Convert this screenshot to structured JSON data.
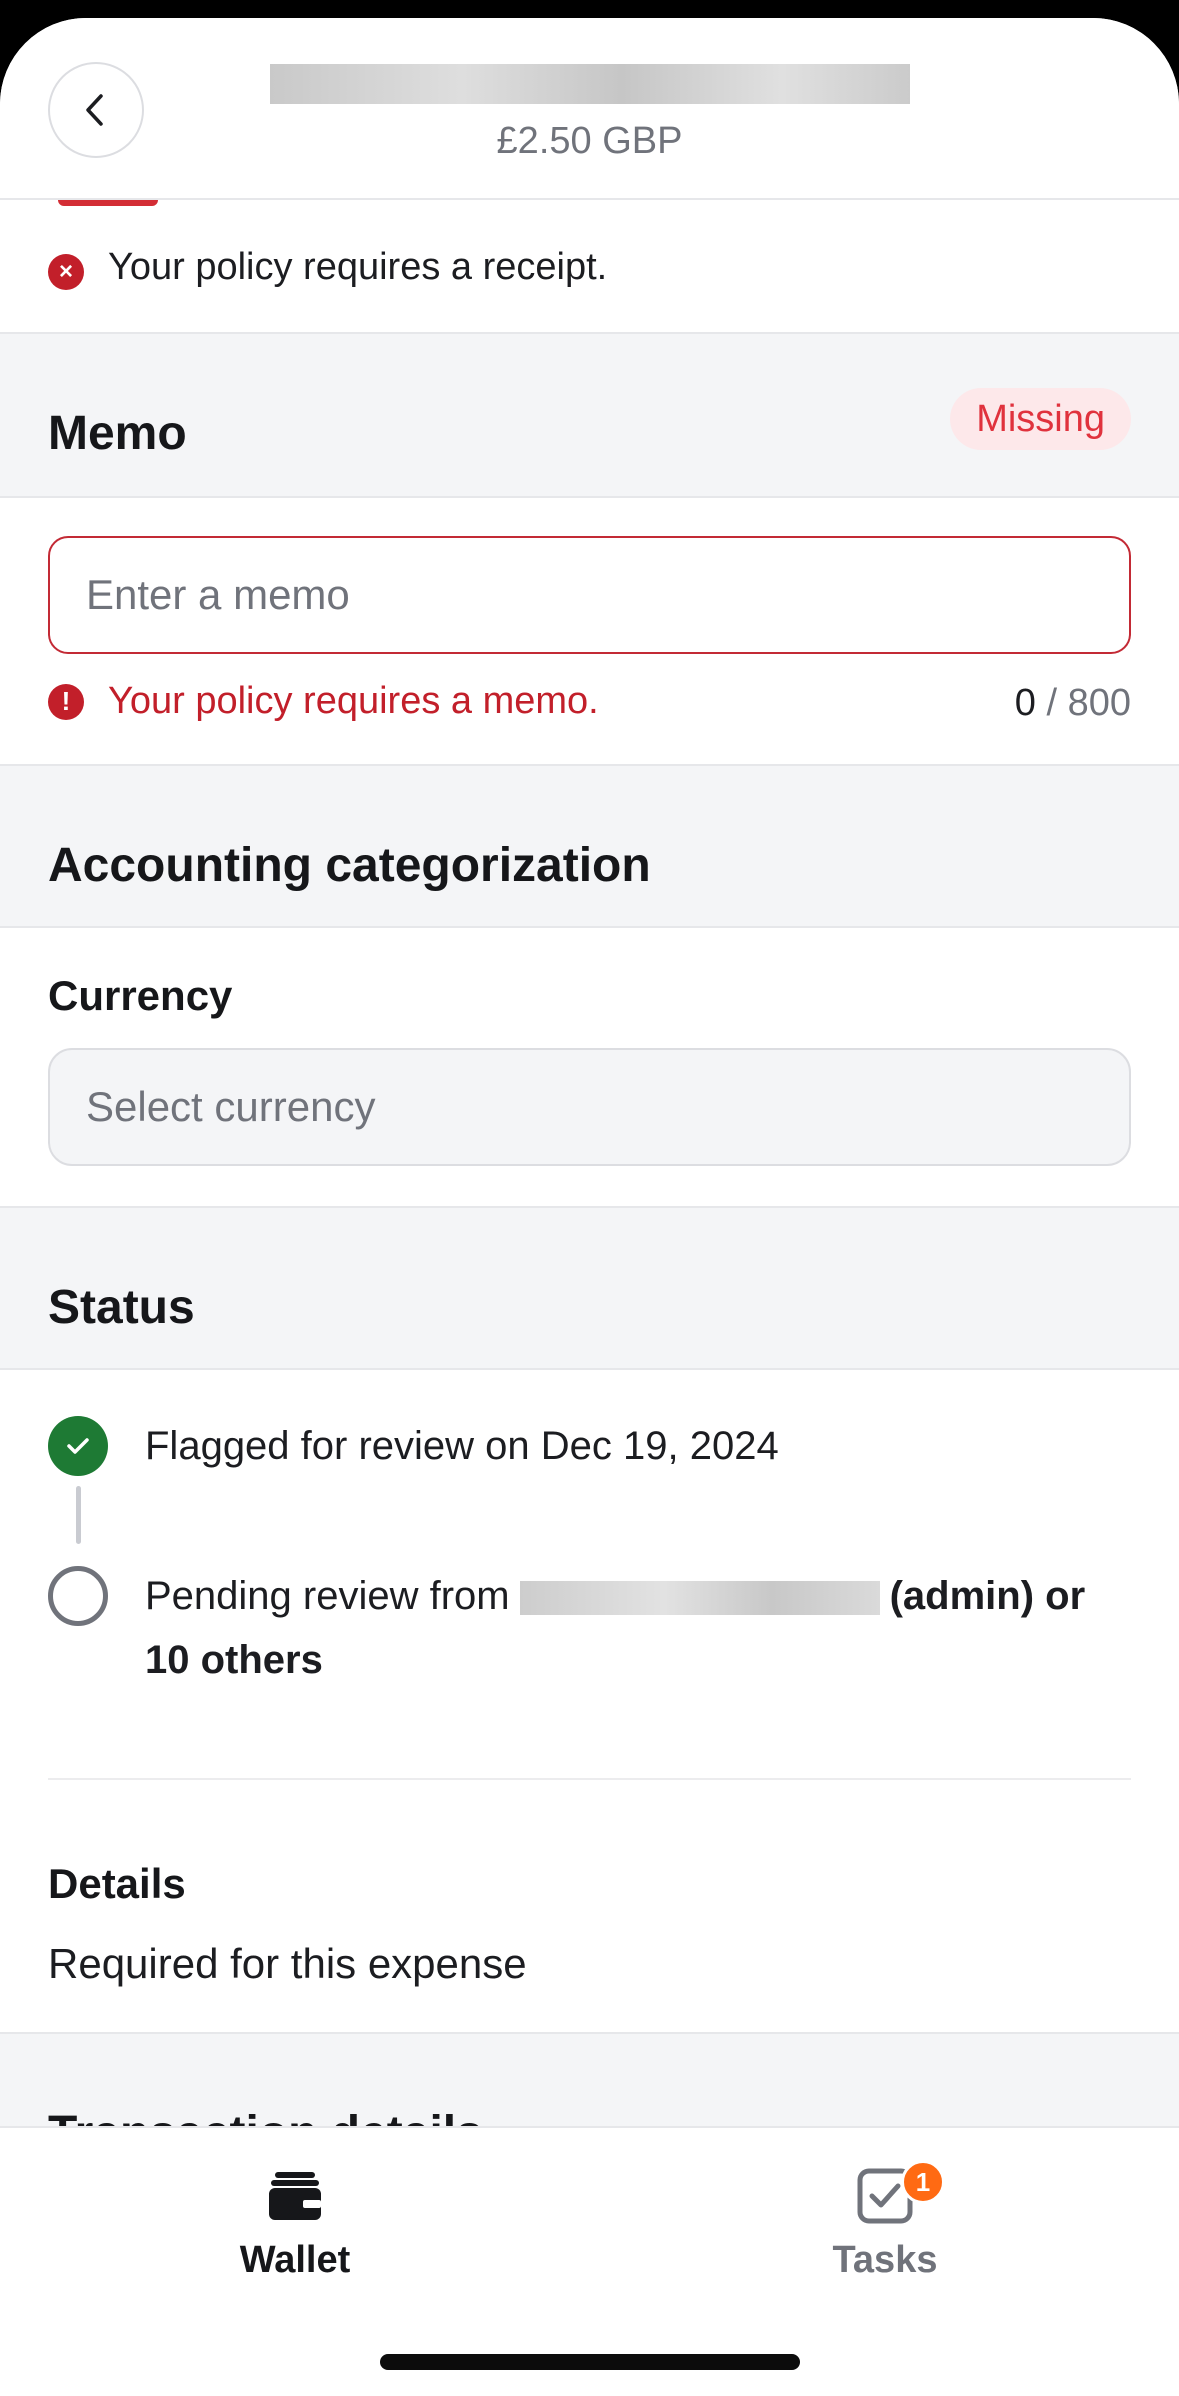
{
  "header": {
    "amount": "£2.50 GBP",
    "back_icon": "chevron-left-icon"
  },
  "receipt_warning": {
    "text": "Your policy requires a receipt.",
    "icon": "error-x-icon"
  },
  "memo": {
    "title": "Memo",
    "badge": "Missing",
    "placeholder": "Enter a memo",
    "value": "",
    "error": "Your policy requires a memo.",
    "count": "0",
    "max": "/ 800"
  },
  "accounting": {
    "title": "Accounting categorization",
    "currency_label": "Currency",
    "currency_placeholder": "Select currency"
  },
  "status": {
    "title": "Status",
    "step1": "Flagged for review on Dec 19, 2024",
    "step2_prefix": "Pending review from",
    "step2_suffix": "(admin) or",
    "step2_tail": "10 others"
  },
  "details": {
    "label": "Details",
    "value": "Required for this expense"
  },
  "transaction": {
    "title": "Transaction details"
  },
  "tabbar": {
    "wallet": "Wallet",
    "tasks": "Tasks",
    "tasks_badge": "1"
  },
  "colors": {
    "error": "#c21f2a",
    "success": "#1e7a34",
    "badge": "#ff6a13",
    "section_bg": "#f4f5f7"
  }
}
